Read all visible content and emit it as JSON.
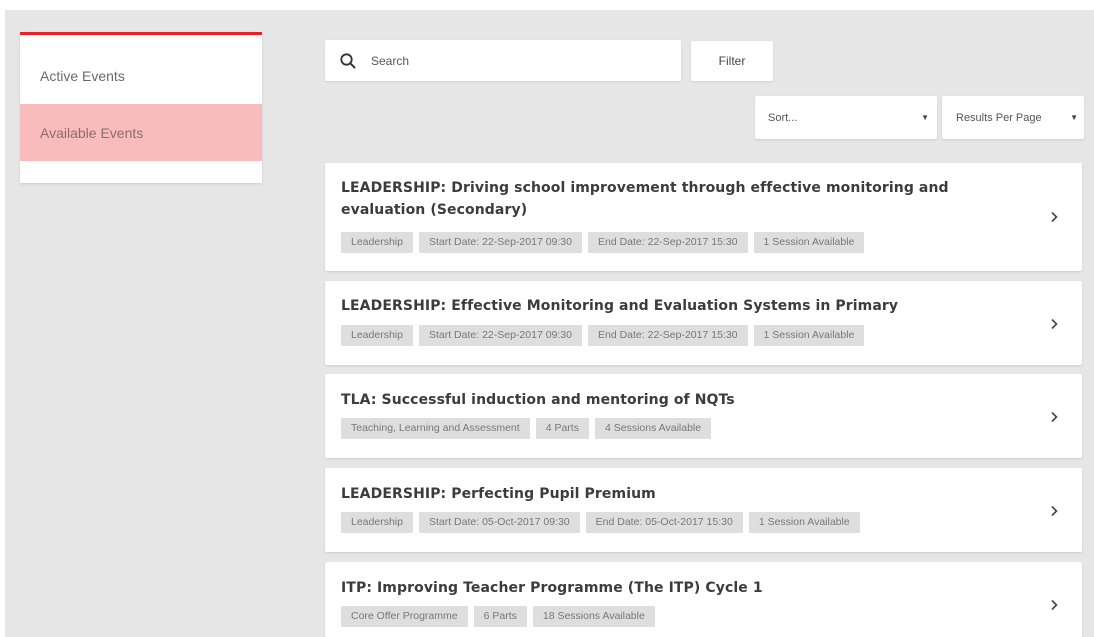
{
  "sidebar": {
    "items": [
      {
        "label": "Active Events",
        "active": false
      },
      {
        "label": "Available Events",
        "active": true
      }
    ]
  },
  "search": {
    "placeholder": "Search",
    "value": ""
  },
  "filter": {
    "label": "Filter"
  },
  "sort": {
    "label": "Sort..."
  },
  "results_per_page": {
    "label": "Results Per Page"
  },
  "colors": {
    "accent": "#e8202a",
    "active_item_bg": "#f9bcbc",
    "background": "#e6e6e6",
    "tag_bg": "#dedede"
  },
  "icons": {
    "search": "search-icon",
    "caret": "caret-down-icon",
    "chevron": "chevron-right-icon"
  },
  "events": [
    {
      "title": "LEADERSHIP: Driving school improvement through effective monitoring and evaluation (Secondary)",
      "tags": [
        "Leadership",
        "Start Date: 22-Sep-2017 09:30",
        "End Date: 22-Sep-2017 15:30",
        "1 Session Available"
      ]
    },
    {
      "title": "LEADERSHIP: Effective Monitoring and Evaluation Systems in Primary",
      "tags": [
        "Leadership",
        "Start Date: 22-Sep-2017 09:30",
        "End Date: 22-Sep-2017 15:30",
        "1 Session Available"
      ]
    },
    {
      "title": "TLA: Successful induction and mentoring of NQTs",
      "tags": [
        "Teaching, Learning and Assessment",
        "4 Parts",
        "4 Sessions Available"
      ]
    },
    {
      "title": "LEADERSHIP: Perfecting Pupil Premium",
      "tags": [
        "Leadership",
        "Start Date: 05-Oct-2017 09:30",
        "End Date: 05-Oct-2017 15:30",
        "1 Session Available"
      ]
    },
    {
      "title": "ITP: Improving Teacher Programme (The ITP) Cycle 1",
      "tags": [
        "Core Offer Programme",
        "6 Parts",
        "18 Sessions Available"
      ]
    }
  ]
}
